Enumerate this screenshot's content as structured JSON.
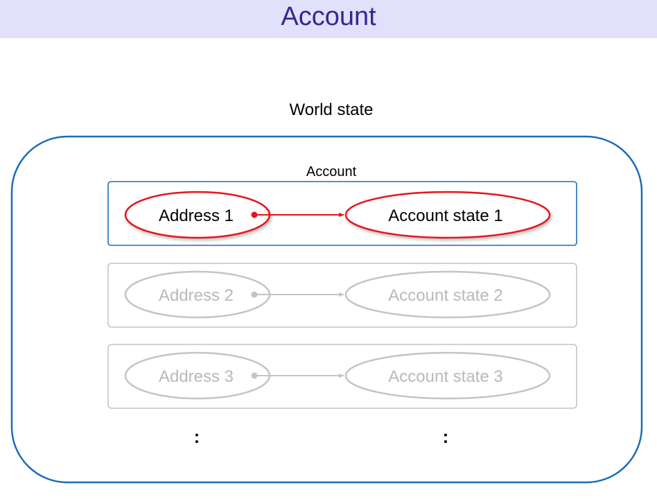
{
  "page": {
    "title": "Account"
  },
  "diagram": {
    "world_state_label": "World state",
    "account_label": "Account",
    "entries": [
      {
        "address": "Address 1",
        "state": "Account state 1",
        "highlighted": true
      },
      {
        "address": "Address 2",
        "state": "Account state 2",
        "highlighted": false
      },
      {
        "address": "Address 3",
        "state": "Account state 3",
        "highlighted": false
      }
    ],
    "continuation_marks": [
      ":",
      ":"
    ]
  },
  "colors": {
    "title_bar_bg": "#e3e0fb",
    "title_text": "#2f2a92",
    "container_border": "#1a6db8",
    "highlight": "#e3141b",
    "muted": "#c4c4c4",
    "muted_text": "#b9b9b9",
    "text": "#000000"
  }
}
